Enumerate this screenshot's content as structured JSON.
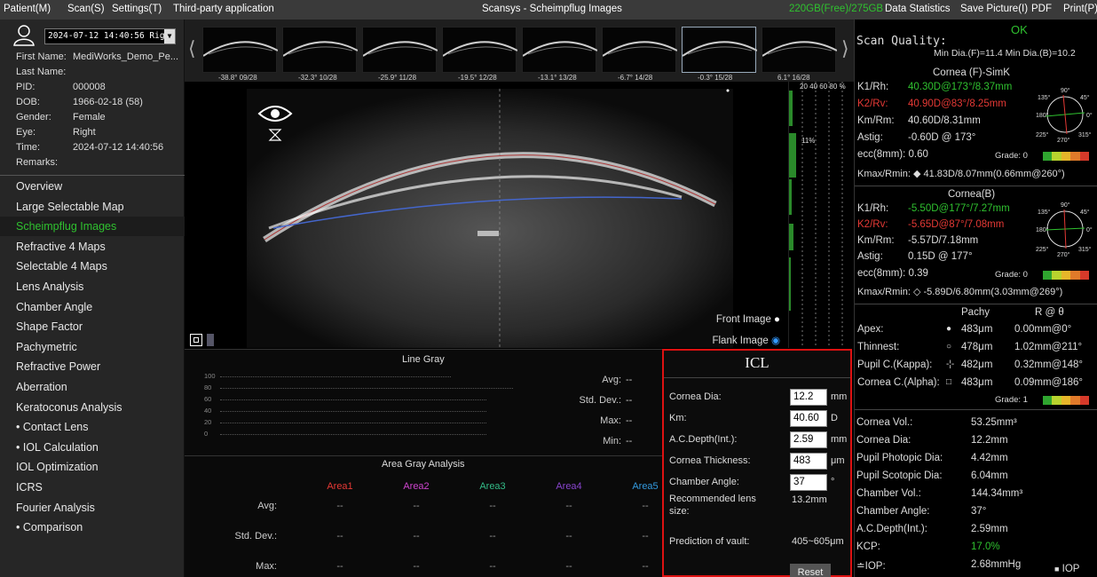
{
  "menubar": {
    "items": [
      "Patient(M)",
      "Scan(S)",
      "Settings(T)",
      "Third-party application"
    ],
    "title": "Scansys - Scheimpflug Images",
    "storage": "220GB(Free)/275GB",
    "right_items": [
      "Data Statistics",
      "Save Picture(I)",
      "PDF",
      "Print(P)"
    ]
  },
  "patient": {
    "exam_select": "2024-07-12 14:40:56 Right",
    "fields": [
      {
        "label": "First Name:",
        "value": "MediWorks_Demo_Pe..."
      },
      {
        "label": "Last Name:",
        "value": ""
      },
      {
        "label": "PID:",
        "value": "000008"
      },
      {
        "label": "DOB:",
        "value": "1966-02-18  (58)"
      },
      {
        "label": "Gender:",
        "value": "Female"
      },
      {
        "label": "Eye:",
        "value": "Right"
      },
      {
        "label": "Time:",
        "value": "2024-07-12 14:40:56"
      },
      {
        "label": "Remarks:",
        "value": ""
      }
    ]
  },
  "nav": {
    "items": [
      "Overview",
      "Large Selectable Map",
      "Scheimpflug Images",
      "Refractive 4 Maps",
      "Selectable 4 Maps",
      "Lens Analysis",
      "Chamber Angle",
      "Shape Factor",
      "Pachymetric",
      "Refractive Power",
      "Aberration",
      "Keratoconus Analysis",
      "• Contact Lens",
      "• IOL Calculation",
      "IOL Optimization",
      "ICRS",
      "Fourier Analysis",
      "• Comparison"
    ],
    "active_index": 2
  },
  "thumbnails": [
    {
      "label": "-38.8° 09/28"
    },
    {
      "label": "-32.3° 10/28"
    },
    {
      "label": "-25.9° 11/28"
    },
    {
      "label": "-19.5° 12/28"
    },
    {
      "label": "-13.1° 13/28"
    },
    {
      "label": "-6.7°  14/28"
    },
    {
      "label": "-0.3°  15/28"
    },
    {
      "label": "6.1°   16/28"
    }
  ],
  "thumb_selected": 6,
  "image_panel": {
    "front_label": "Front Image",
    "flank_label": "Flank Image"
  },
  "sideplot": {
    "ticks": [
      "20",
      "40",
      "60",
      "80",
      "%"
    ],
    "marker": "11%"
  },
  "line_gray": {
    "title": "Line Gray",
    "y_ticks": [
      "100",
      "80",
      "60",
      "40",
      "20",
      "0"
    ],
    "stats": [
      {
        "label": "Avg:",
        "value": "--"
      },
      {
        "label": "Std. Dev.:",
        "value": "--"
      },
      {
        "label": "Max:",
        "value": "--"
      },
      {
        "label": "Min:",
        "value": "--"
      }
    ]
  },
  "area_gray": {
    "title": "Area Gray Analysis",
    "areas": [
      {
        "name": "Area1",
        "color": "#e53935"
      },
      {
        "name": "Area2",
        "color": "#cc44cc"
      },
      {
        "name": "Area3",
        "color": "#33bb88"
      },
      {
        "name": "Area4",
        "color": "#8844cc"
      },
      {
        "name": "Area5",
        "color": "#3399dd"
      }
    ],
    "rows": [
      {
        "label": "Avg:",
        "values": [
          "--",
          "--",
          "--",
          "--",
          "--"
        ]
      },
      {
        "label": "Std. Dev.:",
        "values": [
          "--",
          "--",
          "--",
          "--",
          "--"
        ]
      },
      {
        "label": "Max:",
        "values": [
          "--",
          "--",
          "--",
          "--",
          "--"
        ]
      }
    ]
  },
  "icl": {
    "title": "ICL",
    "inputs": [
      {
        "label": "Cornea Dia:",
        "value": "12.2",
        "unit": "mm"
      },
      {
        "label": "Km:",
        "value": "40.60",
        "unit": "D"
      },
      {
        "label": "A.C.Depth(Int.):",
        "value": "2.59",
        "unit": "mm"
      },
      {
        "label": "Cornea Thickness:",
        "value": "483",
        "unit": "μm"
      },
      {
        "label": "Chamber Angle:",
        "value": "37",
        "unit": "°"
      }
    ],
    "lens_label": "Recommended lens size:",
    "lens_value": "13.2mm",
    "vault_label": "Prediction of vault:",
    "vault_value": "405~605μm",
    "reset_label": "Reset"
  },
  "right": {
    "scan_quality_label": "Scan Quality:",
    "scan_quality_value": "OK",
    "dia_line": "Min Dia.(F)=11.4  Min Dia.(B)=10.2",
    "front": {
      "title": "Cornea (F)-SimK",
      "k1_label": "K1/Rh:",
      "k1": "40.30D@173°/8.37mm",
      "k2_label": "K2/Rv:",
      "k2": "40.90D@83°/8.25mm",
      "km_label": "Km/Rm:",
      "km": "40.60D/8.31mm",
      "astig_label": "Astig:",
      "astig": "-0.60D @ 173°",
      "ecc": "ecc(8mm): 0.60",
      "grade": "Grade: 0",
      "kmax": "Kmax/Rmin: ◆ 41.83D/8.07mm(0.66mm@260°)"
    },
    "back": {
      "title": "Cornea(B)",
      "k1_label": "K1/Rh:",
      "k1": "-5.50D@177°/7.27mm",
      "k2_label": "K2/Rv:",
      "k2": "-5.65D@87°/7.08mm",
      "km_label": "Km/Rm:",
      "km": "-5.57D/7.18mm",
      "astig_label": "Astig:",
      "astig": "0.15D @ 177°",
      "ecc": "ecc(8mm): 0.39",
      "grade": "Grade: 0",
      "kmax": "Kmax/Rmin: ◇ -5.89D/6.80mm(3.03mm@269°)"
    },
    "dial_labels": {
      "top": "90°",
      "tr": "45°",
      "right": "0°",
      "br": "315°",
      "bottom": "270°",
      "bl": "225°",
      "left": "180°",
      "tl": "135°"
    },
    "pachy": {
      "head_pachy": "Pachy",
      "head_r": "R @ θ",
      "rows": [
        {
          "label": "Apex:",
          "sym": "●",
          "val": "483μm",
          "pos": "0.00mm@0°"
        },
        {
          "label": "Thinnest:",
          "sym": "○",
          "val": "478μm",
          "pos": "1.02mm@211°"
        },
        {
          "label": "Pupil C.(Kappa):",
          "sym": "-¦-",
          "val": "482μm",
          "pos": "0.32mm@148°"
        },
        {
          "label": "Cornea C.(Alpha):",
          "sym": "□",
          "val": "483μm",
          "pos": "0.09mm@186°"
        }
      ],
      "grade": "Grade: 1"
    },
    "metrics": [
      {
        "label": "Cornea Vol.:",
        "value": "53.25mm³"
      },
      {
        "label": "Cornea Dia:",
        "value": "12.2mm"
      },
      {
        "label": "Pupil Photopic Dia:",
        "value": "4.42mm"
      },
      {
        "label": "Pupil Scotopic Dia:",
        "value": "6.04mm"
      },
      {
        "label": "Chamber Vol.:",
        "value": "144.34mm³"
      },
      {
        "label": "Chamber Angle:",
        "value": "37°"
      },
      {
        "label": "A.C.Depth(Int.):",
        "value": "2.59mm"
      },
      {
        "label": "KCP:",
        "value": "17.0%"
      },
      {
        "label": "≐IOP:",
        "value": "2.68mmHg"
      }
    ],
    "iop_toggle": "IOP"
  }
}
